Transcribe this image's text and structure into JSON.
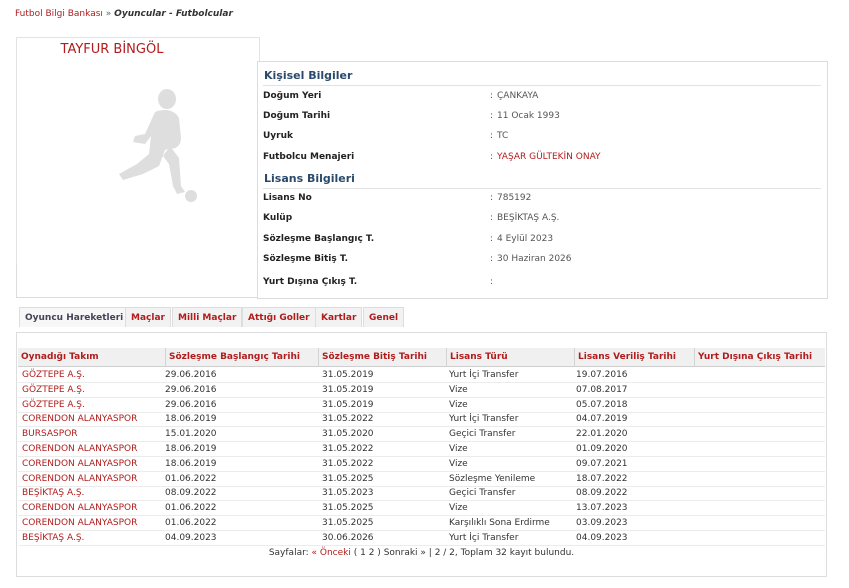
{
  "breadcrumb": {
    "home": "Futbol Bilgi Bankası",
    "sep": "»",
    "current": "Oyuncular - Futbolcular"
  },
  "player": {
    "name": "TAYFUR BİNGÖL"
  },
  "personal": {
    "title": "Kişisel Bilgiler",
    "rows": [
      {
        "label": "Doğum Yeri",
        "value": "ÇANKAYA"
      },
      {
        "label": "Doğum Tarihi",
        "value": "11 Ocak 1993"
      },
      {
        "label": "Uyruk",
        "value": "TC"
      },
      {
        "label": "Futbolcu Menajeri",
        "value": "YAŞAR GÜLTEKİN ONAY"
      }
    ]
  },
  "license": {
    "title": "Lisans Bilgileri",
    "rows": [
      {
        "label": "Lisans No",
        "value": "785192"
      },
      {
        "label": "Kulüp",
        "value": "BEŞİKTAŞ A.Ş."
      },
      {
        "label": "Sözleşme Başlangıç T.",
        "value": "4 Eylül 2023"
      },
      {
        "label": "Sözleşme Bitiş T.",
        "value": "30 Haziran 2026"
      },
      {
        "label": "Yurt Dışına Çıkış T.",
        "value": ""
      }
    ]
  },
  "colon": ":",
  "tabs": [
    "Oyuncu Hareketleri",
    "Maçlar",
    "Milli Maçlar",
    "Attığı Goller",
    "Kartlar",
    "Genel"
  ],
  "table": {
    "headers": [
      "Oynadığı Takım",
      "Sözleşme Başlangıç Tarihi",
      "Sözleşme Bitiş Tarihi",
      "Lisans Türü",
      "Lisans Veriliş Tarihi",
      "Yurt Dışına Çıkış Tarihi"
    ],
    "rows": [
      [
        "GÖZTEPE A.Ş.",
        "29.06.2016",
        "31.05.2019",
        "Yurt İçi Transfer",
        "19.07.2016",
        ""
      ],
      [
        "GÖZTEPE A.Ş.",
        "29.06.2016",
        "31.05.2019",
        "Vize",
        "07.08.2017",
        ""
      ],
      [
        "GÖZTEPE A.Ş.",
        "29.06.2016",
        "31.05.2019",
        "Vize",
        "05.07.2018",
        ""
      ],
      [
        "CORENDON ALANYASPOR",
        "18.06.2019",
        "31.05.2022",
        "Yurt İçi Transfer",
        "04.07.2019",
        ""
      ],
      [
        "BURSASPOR",
        "15.01.2020",
        "31.05.2020",
        "Geçici Transfer",
        "22.01.2020",
        ""
      ],
      [
        "CORENDON ALANYASPOR",
        "18.06.2019",
        "31.05.2022",
        "Vize",
        "01.09.2020",
        ""
      ],
      [
        "CORENDON ALANYASPOR",
        "18.06.2019",
        "31.05.2022",
        "Vize",
        "09.07.2021",
        ""
      ],
      [
        "CORENDON ALANYASPOR",
        "01.06.2022",
        "31.05.2025",
        "Sözleşme Yenileme",
        "18.07.2022",
        ""
      ],
      [
        "BEŞİKTAŞ A.Ş.",
        "08.09.2022",
        "31.05.2023",
        "Geçici Transfer",
        "08.09.2022",
        ""
      ],
      [
        "CORENDON ALANYASPOR",
        "01.06.2022",
        "31.05.2025",
        "Vize",
        "13.07.2023",
        ""
      ],
      [
        "CORENDON ALANYASPOR",
        "01.06.2022",
        "31.05.2025",
        "Karşılıklı Sona Erdirme",
        "03.09.2023",
        ""
      ],
      [
        "BEŞİKTAŞ A.Ş.",
        "04.09.2023",
        "30.06.2026",
        "Yurt İçi Transfer",
        "04.09.2023",
        ""
      ]
    ]
  },
  "pager": {
    "label": "Sayfalar:",
    "prev": "« Önceki",
    "pages": "( 1 2 )",
    "next": "Sonraki »",
    "summary": "| 2 / 2, Toplam 32 kayıt bulundu."
  }
}
